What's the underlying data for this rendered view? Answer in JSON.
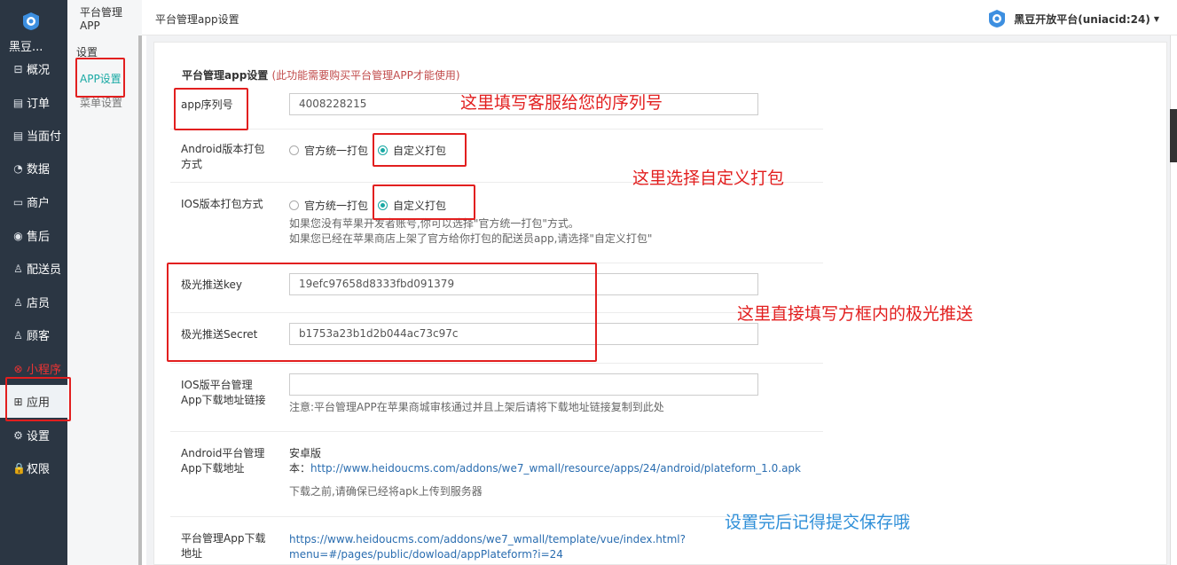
{
  "sidebar": {
    "brand": "黑豆...",
    "items": [
      {
        "label": "概况",
        "icon": "overview-icon",
        "glyph": "⊟"
      },
      {
        "label": "订单",
        "icon": "order-icon",
        "glyph": "▤"
      },
      {
        "label": "当面付",
        "icon": "face-pay-icon",
        "glyph": "▤"
      },
      {
        "label": "数据",
        "icon": "data-icon",
        "glyph": "◔"
      },
      {
        "label": "商户",
        "icon": "merchant-icon",
        "glyph": "▭"
      },
      {
        "label": "售后",
        "icon": "after-sale-icon",
        "glyph": "◉"
      },
      {
        "label": "配送员",
        "icon": "courier-icon",
        "glyph": "♙"
      },
      {
        "label": "店员",
        "icon": "clerk-icon",
        "glyph": "♙"
      },
      {
        "label": "顾客",
        "icon": "customer-icon",
        "glyph": "♙"
      },
      {
        "label": "小程序",
        "icon": "miniprogram-icon",
        "glyph": "⊗"
      },
      {
        "label": "应用",
        "icon": "apps-icon",
        "glyph": "⊞"
      },
      {
        "label": "设置",
        "icon": "gear-icon",
        "glyph": "⚙"
      },
      {
        "label": "权限",
        "icon": "lock-icon",
        "glyph": "🔒"
      }
    ]
  },
  "submenu": {
    "top": "平台管理APP",
    "group": "设置",
    "items": [
      "APP设置",
      "菜单设置"
    ]
  },
  "header": {
    "breadcrumb": "平台管理app设置",
    "account": "黑豆开放平台(uniacid:24)"
  },
  "form": {
    "title": "平台管理app设置",
    "title_note": "(此功能需要购买平台管理APP才能使用)",
    "serial_label": "app序列号",
    "serial_value": "4008228215",
    "android_pack_label_1": "Android版本打包",
    "android_pack_label_2": "方式",
    "ios_pack_label": "IOS版本打包方式",
    "option_official": "官方统一打包",
    "option_custom": "自定义打包",
    "ios_hint_1": "如果您没有苹果开发者账号,你可以选择\"官方统一打包\"方式。",
    "ios_hint_2": "如果您已经在苹果商店上架了官方给你打包的配送员app,请选择\"自定义打包\"",
    "jpush_key_label": "极光推送key",
    "jpush_key_value": "19efc97658d8333fbd091379",
    "jpush_secret_label": "极光推送Secret",
    "jpush_secret_value": "b1753a23b1d2b044ac73c97c",
    "ios_link_label_1": "IOS版平台管理",
    "ios_link_label_2": "App下载地址链接",
    "ios_link_value": "",
    "ios_link_hint": "注意:平台管理APP在苹果商城审核通过并且上架后请将下载地址链接复制到此处",
    "android_dl_label_1": "Android平台管理",
    "android_dl_label_2": "App下载地址",
    "android_dl_version": "安卓版",
    "android_dl_prefix": "本：",
    "android_dl_url": "http://www.heidoucms.com/addons/we7_wmall/resource/apps/24/android/plateform_1.0.apk",
    "android_dl_hint": "下载之前,请确保已经将apk上传到服务器",
    "platform_dl_label_1": "平台管理App下载",
    "platform_dl_label_2": "地址",
    "platform_dl_url_1": "https://www.heidoucms.com/addons/we7_wmall/template/vue/index.html?",
    "platform_dl_url_2": "menu=#/pages/public/dowload/appPlateform?i=24"
  },
  "annotations": {
    "serial": "这里填写客服给您的序列号",
    "custom_pack": "这里选择自定义打包",
    "jpush": "这里直接填写方框内的极光推送",
    "save": "设置完后记得提交保存哦"
  },
  "colors": {
    "sidebar_bg": "#2b3643",
    "accent": "#19a9a4",
    "annotation_red": "#e21f1f",
    "annotation_blue": "#2f8fd8"
  }
}
